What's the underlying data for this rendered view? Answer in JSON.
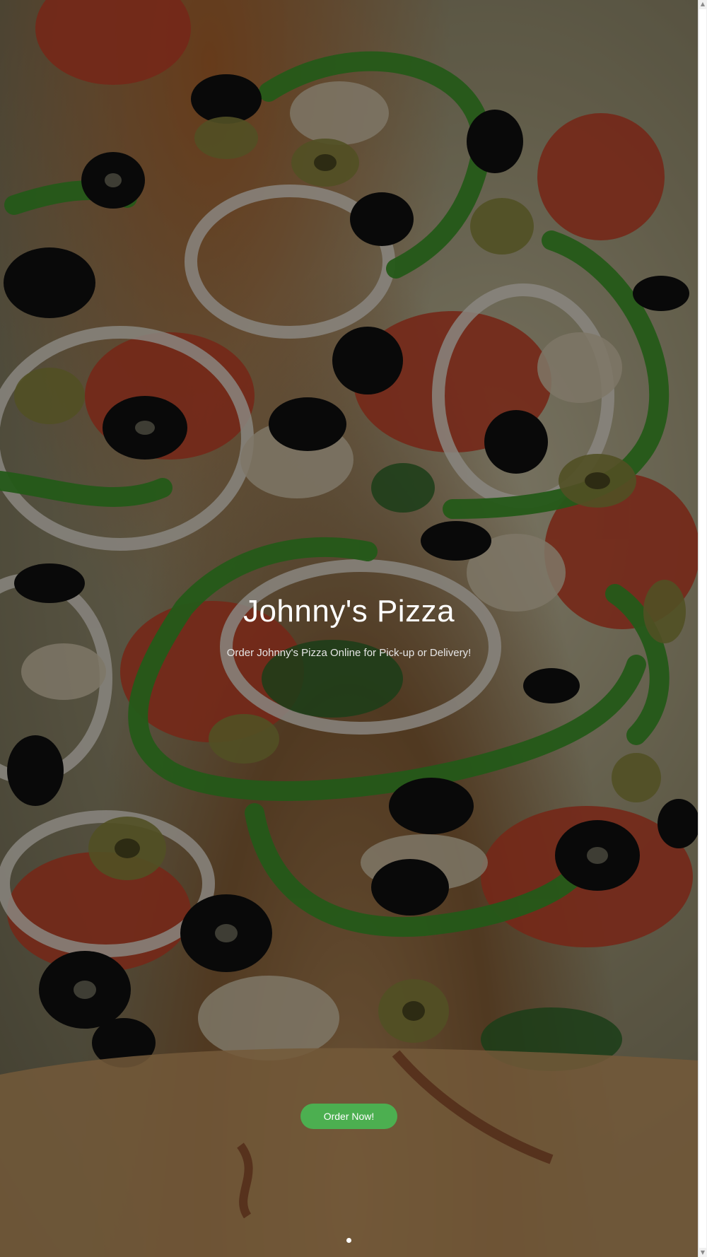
{
  "hero": {
    "title": "Johnny's Pizza",
    "subtitle": "Order Johnny's Pizza Online for Pick-up or Delivery!",
    "order_button_label": "Order Now!"
  },
  "scrollbar": {
    "up_icon": "▲",
    "down_icon": "▼"
  },
  "colors": {
    "accent": "#4caf50",
    "text": "#ffffff"
  },
  "icons": {
    "scroll_up": "triangle-up-icon",
    "scroll_down": "triangle-down-icon",
    "scroll_indicator": "dot-icon"
  }
}
